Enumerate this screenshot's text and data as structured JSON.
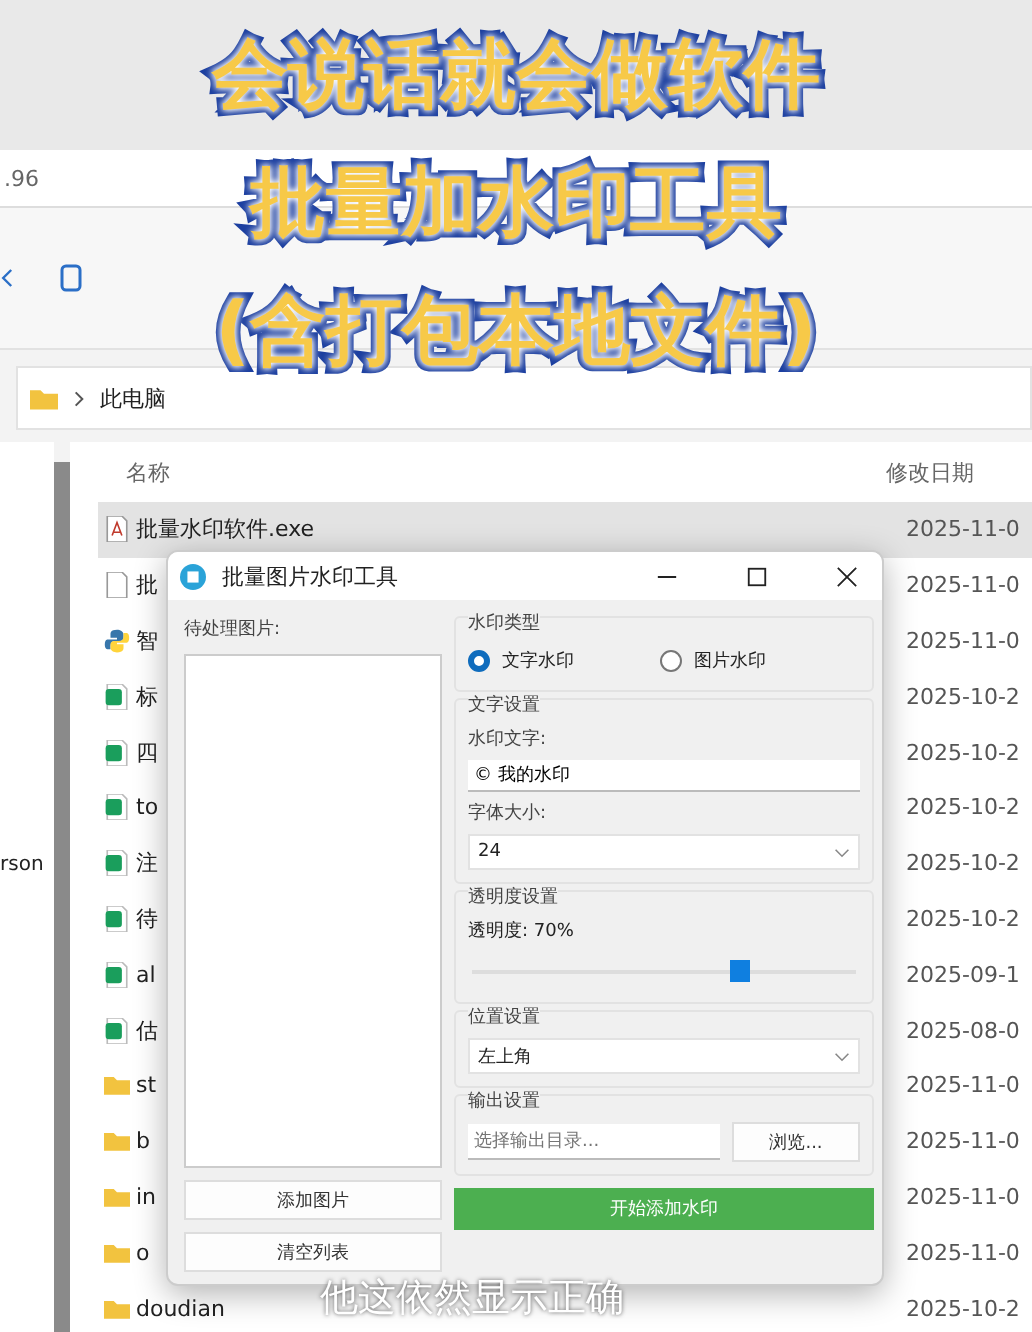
{
  "captions": [
    "会说话就会做软件",
    "批量加水印工具",
    "(含打包本地文件)"
  ],
  "subtitle": "他这依然显示正确",
  "explorer": {
    "address": ".96",
    "breadcrumb": "此电脑",
    "sidebar_text": "rson",
    "columns": [
      "名称",
      "修改日期"
    ],
    "rows": [
      {
        "kind": "exe",
        "name": "批量水印软件.exe",
        "date": "2025-11-0",
        "selected": true
      },
      {
        "kind": "file",
        "name": "批",
        "date": "2025-11-0",
        "selected": false
      },
      {
        "kind": "python",
        "name": "智",
        "date": "2025-11-0",
        "selected": false
      },
      {
        "kind": "sheet",
        "name": "标",
        "date": "2025-10-2",
        "selected": false
      },
      {
        "kind": "sheet",
        "name": "四",
        "date": "2025-10-2",
        "selected": false
      },
      {
        "kind": "sheet",
        "name": "to",
        "date": "2025-10-2",
        "selected": false
      },
      {
        "kind": "sheet",
        "name": "注",
        "date": "2025-10-2",
        "selected": false
      },
      {
        "kind": "sheet",
        "name": "待",
        "date": "2025-10-2",
        "selected": false
      },
      {
        "kind": "sheet",
        "name": "al",
        "date": "2025-09-1",
        "selected": false
      },
      {
        "kind": "sheet",
        "name": "估",
        "date": "2025-08-0",
        "selected": false
      },
      {
        "kind": "folder",
        "name": "st",
        "date": "2025-11-0",
        "selected": false
      },
      {
        "kind": "folder",
        "name": "b",
        "date": "2025-11-0",
        "selected": false
      },
      {
        "kind": "folder",
        "name": "in",
        "date": "2025-11-0",
        "selected": false
      },
      {
        "kind": "folder",
        "name": "o",
        "date": "2025-11-0",
        "selected": false
      },
      {
        "kind": "folder",
        "name": "doudian",
        "date": "2025-10-2",
        "selected": false
      }
    ]
  },
  "dialog": {
    "title": "批量图片水印工具",
    "list_label": "待处理图片:",
    "add_button": "添加图片",
    "clear_button": "清空列表",
    "type_group": {
      "title": "水印类型",
      "options": [
        {
          "label": "文字水印",
          "selected": true
        },
        {
          "label": "图片水印",
          "selected": false
        }
      ]
    },
    "text_group": {
      "title": "文字设置",
      "text_label": "水印文字:",
      "text_value": "© 我的水印",
      "size_label": "字体大小:",
      "size_value": "24"
    },
    "opacity_group": {
      "title": "透明度设置",
      "reading": "透明度: 70%",
      "level": 0.7
    },
    "position_group": {
      "title": "位置设置",
      "value": "左上角"
    },
    "output_group": {
      "title": "输出设置",
      "placeholder": "选择输出目录...",
      "browse_button": "浏览..."
    },
    "start_button": "开始添加水印"
  }
}
